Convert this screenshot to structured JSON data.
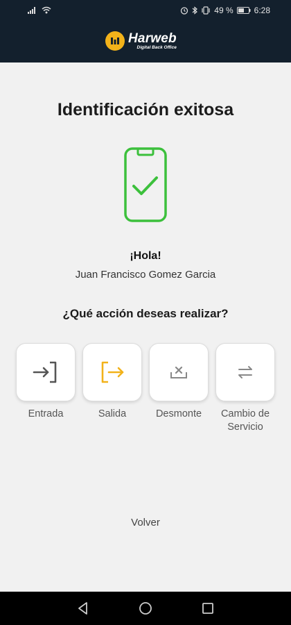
{
  "status_bar": {
    "battery": "49 %",
    "time": "6:28"
  },
  "header": {
    "brand_name": "Harweb",
    "brand_tagline": "Digital Back Office"
  },
  "screen": {
    "title": "Identificación exitosa",
    "greeting": "¡Hola!",
    "user_name": "Juan Francisco Gomez Garcia",
    "question": "¿Qué acción deseas realizar?"
  },
  "actions": [
    {
      "label": "Entrada",
      "icon": "login-icon",
      "color": "#555555"
    },
    {
      "label": "Salida",
      "icon": "logout-icon",
      "color": "#f2b21a"
    },
    {
      "label": "Desmonte",
      "icon": "dismount-icon",
      "color": "#888888"
    },
    {
      "label": "Cambio de Servicio",
      "icon": "swap-icon",
      "color": "#888888"
    }
  ],
  "back_label": "Volver",
  "colors": {
    "success": "#3cc03c",
    "accent": "#f2b21a",
    "header_bg": "#13202d"
  }
}
